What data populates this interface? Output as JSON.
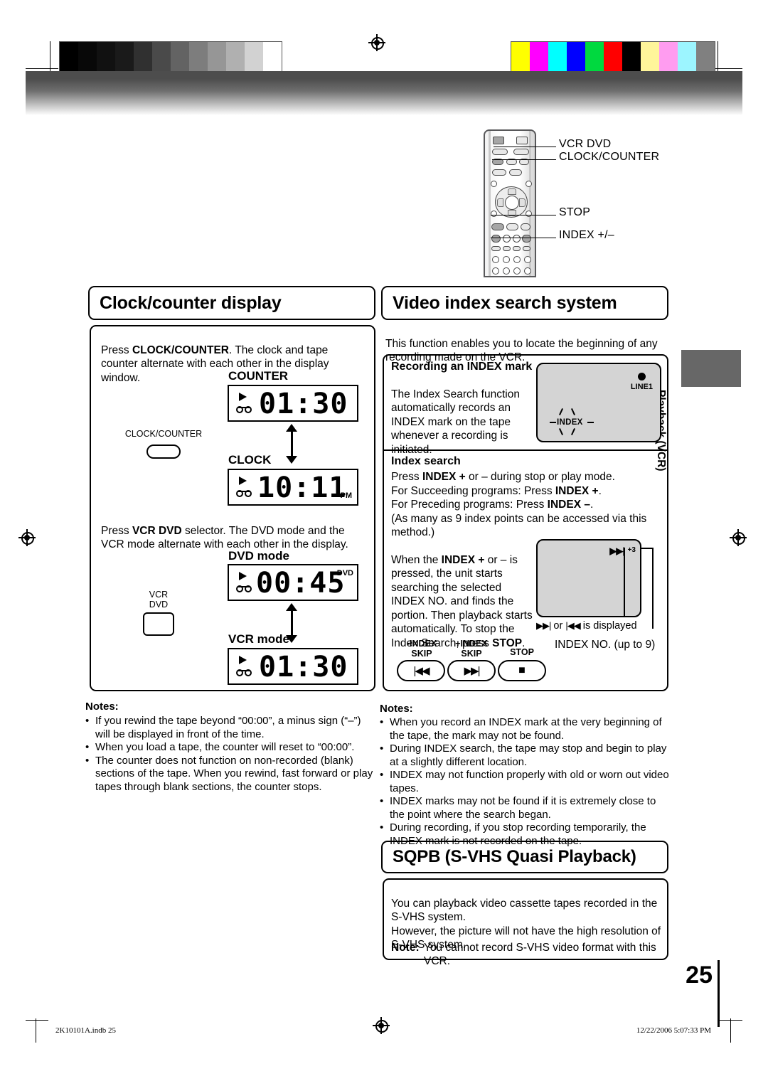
{
  "page": {
    "number": "25",
    "footer_left": "2K10101A.indb   25",
    "footer_right": "12/22/2006   5:07:33 PM"
  },
  "side_tab": {
    "label": "Playback (VCR)"
  },
  "remote_callouts": [
    {
      "label": "VCR DVD"
    },
    {
      "label": "CLOCK/COUNTER"
    },
    {
      "label": "STOP"
    },
    {
      "label": "INDEX +/–"
    }
  ],
  "left_column": {
    "header": "Clock/counter display",
    "intro_prefix": "Press ",
    "intro_bold": "CLOCK/COUNTER",
    "intro_suffix": ". The clock and tape counter alternate with each other in the display window.",
    "counter_label": "COUNTER",
    "counter_display": "01:30",
    "clock_label": "CLOCK",
    "clock_display": "10:11",
    "clock_suffix": "PM",
    "clock_counter_button_label": "CLOCK/COUNTER",
    "second_prefix": "Press ",
    "second_bold": "VCR DVD",
    "second_suffix": " selector. The DVD mode and the VCR mode alternate with each other in the display.",
    "dvd_mode_label": "DVD mode",
    "dvd_display": "00:45",
    "dvd_suffix": "DVD",
    "vcr_mode_label": "VCR mode",
    "vcr_display": "01:30",
    "vcr_dvd_button_line1": "VCR",
    "vcr_dvd_button_line2": "DVD",
    "notes_title": "Notes:",
    "notes": [
      "If you rewind the tape beyond “00:00”, a minus sign (“–”) will be displayed in front of the time.",
      "When you load a tape, the counter will reset to “00:00”.",
      "The counter does not function on non-recorded (blank) sections of the tape. When you rewind, fast forward or play tapes through blank sections, the counter stops."
    ]
  },
  "right_column": {
    "header": "Video index search system",
    "intro": "This function enables you to locate the beginning of any recording made on the VCR.",
    "rec_index_title": "Recording an INDEX mark",
    "rec_index_body": "The Index Search function automatically records an INDEX mark on the tape whenever a recording is initiated.",
    "screen1_line_label": "LINE1",
    "screen1_index_label": "INDEX",
    "index_search_title": "Index search",
    "index_search_lines": [
      {
        "pre": "Press ",
        "bold": "INDEX +",
        "post": " or – during stop or play mode."
      },
      {
        "pre": "For Succeeding programs: Press ",
        "bold": "INDEX +",
        "post": "."
      },
      {
        "pre": "For Preceding programs: Press ",
        "bold": "INDEX –",
        "post": "."
      },
      {
        "pre": "(As many as 9 index points can be accessed via this method.)",
        "bold": "",
        "post": ""
      }
    ],
    "when_index_pre": "When the ",
    "when_index_bold": "INDEX +",
    "when_index_mid": " or – is pressed, the unit starts searching the selected INDEX NO. and finds the portion. Then playback starts automatically. To stop the Index Search, press ",
    "when_index_bold2": "STOP",
    "when_index_post": ".",
    "screen2_badge": "+3",
    "screen2_caption_displayed": "is displayed",
    "screen2_caption_or": "or",
    "screen2_caption_index_no": "INDEX NO. (up to 9)",
    "buttons": [
      {
        "line1": "-INDEX",
        "line2": "SKIP",
        "glyph": "prev"
      },
      {
        "line1": "+INDEX",
        "line2": "SKIP",
        "glyph": "next"
      },
      {
        "line1": "STOP",
        "line2": "",
        "glyph": "stop"
      }
    ],
    "notes_title": "Notes:",
    "notes": [
      "When you record an INDEX mark at the very beginning of the tape, the mark may not be found.",
      "During INDEX search, the tape may stop and begin to play at a slightly different location.",
      "INDEX may not function properly with old or worn out video tapes.",
      "INDEX marks may not be found if it is extremely close to the point where the search began.",
      "During recording, if you stop recording temporarily, the INDEX mark is not recorded on the tape."
    ],
    "sqpb_header": "SQPB (S-VHS Quasi Playback)",
    "sqpb_body1": "You can playback video cassette tapes recorded in the S-VHS system.",
    "sqpb_body2": "However, the picture will not have the high resolution of S-VHS system.",
    "sqpb_note_label": "Note:",
    "sqpb_note_text": "You cannot record S-VHS video format with this VCR."
  },
  "calibration": {
    "gray_wedge": [
      "#000000",
      "#080808",
      "#111111",
      "#1a1a1a",
      "#303030",
      "#4a4a4a",
      "#636363",
      "#7d7d7d",
      "#969696",
      "#b0b0b0",
      "#d2d2d2",
      "#ffffff"
    ],
    "color_bars": [
      "#ffff00",
      "#ff00ff",
      "#00ffff",
      "#0000ff",
      "#00d93f",
      "#ff0000",
      "#000000",
      "#fff59a",
      "#ff9cf0",
      "#9cf5ff",
      "#808080"
    ]
  }
}
